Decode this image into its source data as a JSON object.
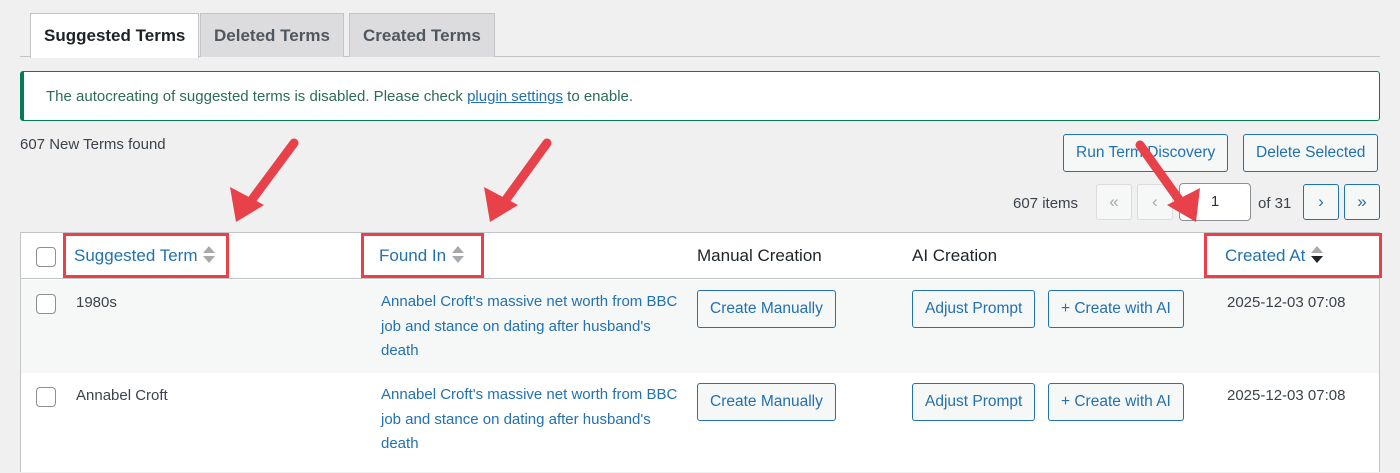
{
  "tabs": [
    {
      "label": "Suggested Terms",
      "active": true
    },
    {
      "label": "Deleted Terms",
      "active": false
    },
    {
      "label": "Created Terms",
      "active": false
    }
  ],
  "notice": {
    "text_before": "The autocreating of suggested terms is disabled. Please check ",
    "link_text": "plugin settings",
    "text_after": " to enable."
  },
  "summary": "607 New Terms found",
  "actions": {
    "run_discovery": "Run Term Discovery",
    "delete_selected": "Delete Selected"
  },
  "pagination": {
    "items": "607 items",
    "first": "«",
    "prev": "‹",
    "current_page": "1",
    "of_total": "of 31",
    "next": "›",
    "last": "»"
  },
  "table": {
    "columns": {
      "suggested_term": "Suggested Term",
      "found_in": "Found In",
      "manual_creation": "Manual Creation",
      "ai_creation": "AI Creation",
      "created_at": "Created At"
    },
    "rows": [
      {
        "term": "1980s",
        "found_in": "Annabel Croft's massive net worth from BBC job and stance on dating after husband's death",
        "create_manually": "Create Manually",
        "adjust_prompt": "Adjust Prompt",
        "create_ai": "+ Create with AI",
        "created_at": "2025-12-03 07:08"
      },
      {
        "term": "Annabel Croft",
        "found_in": "Annabel Croft's massive net worth from BBC job and stance on dating after husband's death",
        "create_manually": "Create Manually",
        "adjust_prompt": "Adjust Prompt",
        "create_ai": "+ Create with AI",
        "created_at": "2025-12-03 07:08"
      }
    ]
  },
  "colors": {
    "accent": "#2271b1",
    "annotation": "#e8414a",
    "notice_border": "#007e5a"
  }
}
